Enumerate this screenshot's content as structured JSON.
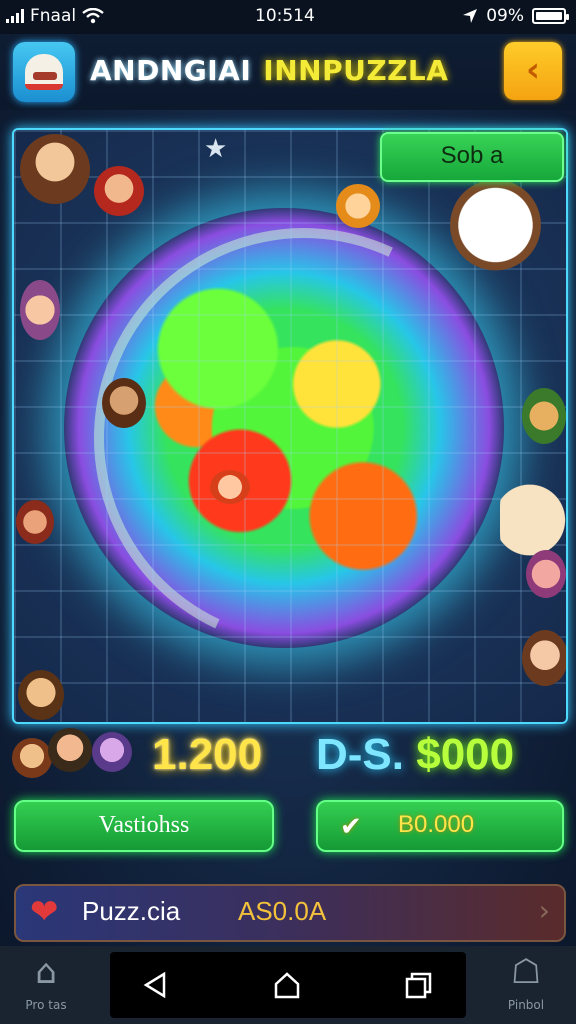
{
  "status_bar": {
    "carrier": "Fnaal",
    "time": "10:514",
    "battery": "09%"
  },
  "header": {
    "title_part1": "ANDNGIAI",
    "title_part2": "INNPUZZLA",
    "back_icon": "chevron-left-icon",
    "app_icon": "helmet-icon"
  },
  "board": {
    "solve_button": "Sob a"
  },
  "scores": {
    "score_left": "1.200",
    "score_right_prefix": "D-S.",
    "score_right_value": "$000"
  },
  "actions": {
    "left_button": "Vastiohss",
    "right_button": "B0.000",
    "right_icon": "check-icon"
  },
  "puzzle_bar": {
    "label": "Puzz.cia",
    "code": "AS0.0A",
    "icon": "heart-icon"
  },
  "bottom_nav": {
    "tab_left_label": "Pro tas",
    "tab_right_label": "Pinbol",
    "tab_left_icon": "home-icon",
    "tab_right_icon": "basket-icon"
  },
  "colors": {
    "accent_green": "#2ad457",
    "accent_yellow": "#ffe44a",
    "accent_cyan": "#4ed9ff",
    "back_button": "#ffc21a"
  }
}
